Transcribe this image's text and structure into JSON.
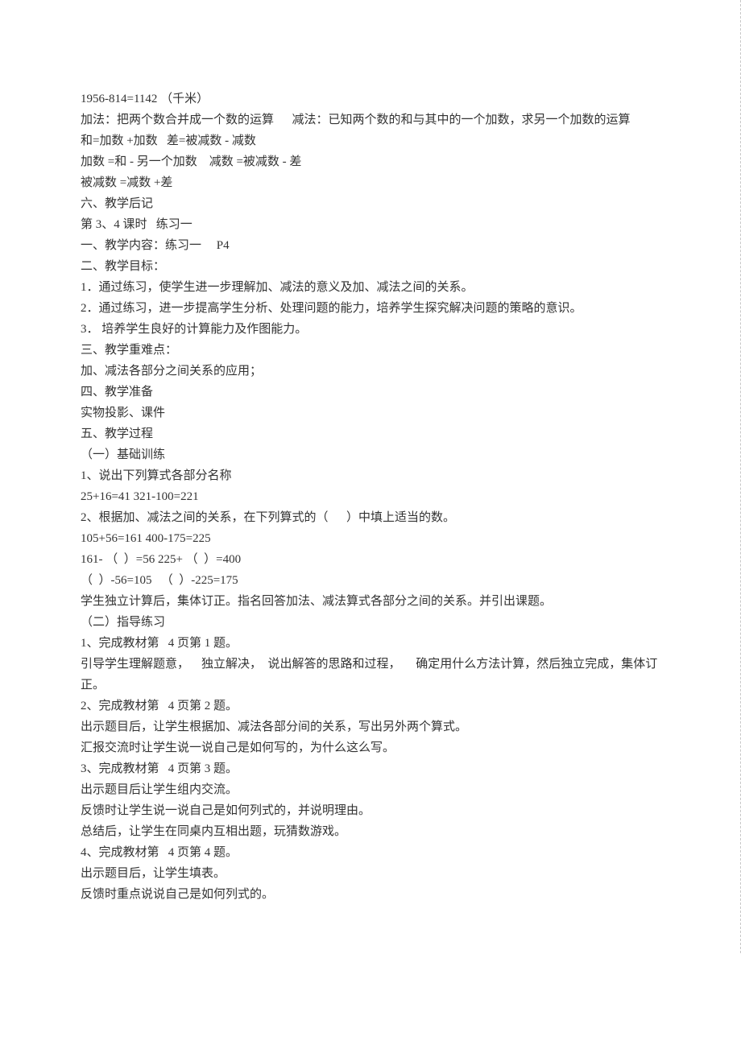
{
  "lines": [
    "1956-814=1142 （千米）",
    "加法：把两个数合并成一个数的运算      减法：已知两个数的和与其中的一个加数，求另一个加数的运算",
    "和=加数 +加数   差=被减数 - 减数",
    "加数 =和 - 另一个加数    减数 =被减数 - 差",
    "被减数 =减数 +差",
    "六、教学后记",
    "",
    "第 3、4 课时   练习一",
    "一、教学内容：练习一     P4",
    "二、教学目标：",
    "1．通过练习，使学生进一步理解加、减法的意义及加、减法之间的关系。",
    "2．通过练习，进一步提高学生分析、处理问题的能力，培养学生探究解决问题的策略的意识。",
    "3． 培养学生良好的计算能力及作图能力。",
    "三、教学重难点：",
    "加、减法各部分之间关系的应用；",
    "四、教学准备",
    "实物投影、课件",
    "五、教学过程",
    "（一）基础训练",
    "1、说出下列算式各部分名称",
    "25+16=41 321-100=221",
    "2、根据加、减法之间的关系，在下列算式的（      ）中填上适当的数。",
    "105+56=161 400-175=225",
    "161- （  ）=56 225+ （  ）=400",
    "（  ）-56=105   （  ）-225=175",
    "学生独立计算后，集体订正。指名回答加法、减法算式各部分之间的关系。并引出课题。",
    "（二）指导练习",
    "1、完成教材第   4 页第 1 题。",
    "引导学生理解题意，    独立解决，  说出解答的思路和过程，     确定用什么方法计算，然后独立完成，集体订正。",
    "2、完成教材第   4 页第 2 题。",
    "出示题目后，让学生根据加、减法各部分间的关系，写出另外两个算式。",
    "汇报交流时让学生说一说自己是如何写的，为什么这么写。",
    "3、完成教材第   4 页第 3 题。",
    "出示题目后让学生组内交流。",
    "反馈时让学生说一说自己是如何列式的，并说明理由。",
    "总结后，让学生在同桌内互相出题，玩猜数游戏。",
    "4、完成教材第   4 页第 4 题。",
    "出示题目后，让学生填表。",
    "反馈时重点说说自己是如何列式的。"
  ]
}
